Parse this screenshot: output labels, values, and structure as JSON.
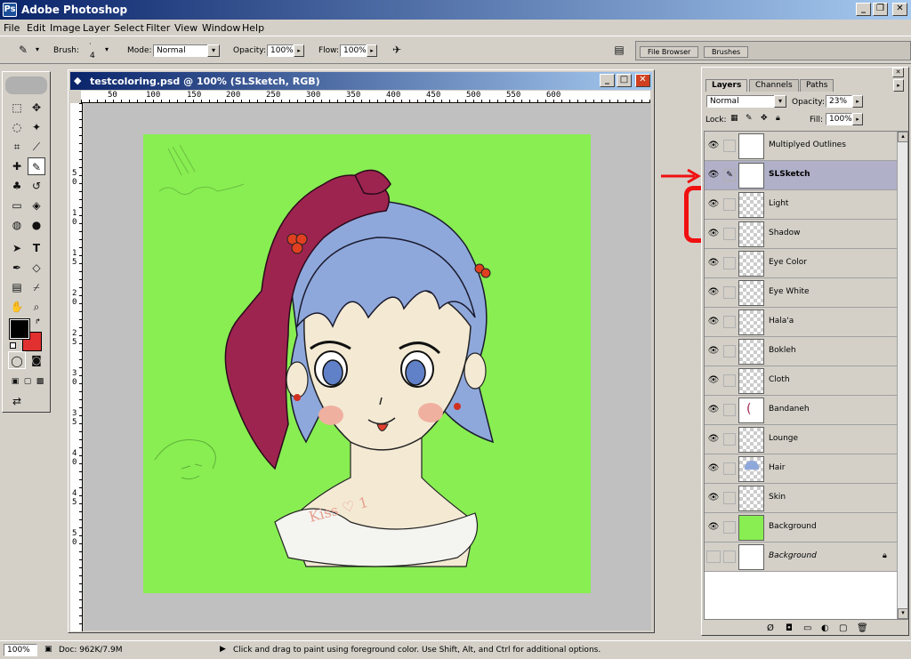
{
  "app": {
    "title": "Adobe Photoshop"
  },
  "menu": [
    "File",
    "Edit",
    "Image",
    "Layer",
    "Select",
    "Filter",
    "View",
    "Window",
    "Help"
  ],
  "options": {
    "brush_label": "Brush:",
    "brush_size": "4",
    "mode_label": "Mode:",
    "mode_value": "Normal",
    "opacity_label": "Opacity:",
    "opacity_value": "100%",
    "flow_label": "Flow:",
    "flow_value": "100%"
  },
  "palette_well": {
    "tabs": [
      "File Browser",
      "Brushes"
    ]
  },
  "document": {
    "title": "testcoloring.psd @ 100% (SLSketch, RGB)",
    "ruler_h": [
      "50",
      "100",
      "150",
      "200",
      "250",
      "300",
      "350",
      "400",
      "450",
      "500",
      "550",
      "600"
    ],
    "ruler_v": [
      "5",
      "0",
      "1",
      "0",
      "1",
      "5",
      "2",
      "0",
      "2",
      "5",
      "3",
      "0",
      "3",
      "5",
      "4",
      "0",
      "4",
      "5",
      "5",
      "0"
    ]
  },
  "layers_panel": {
    "tabs": [
      "Layers",
      "Channels",
      "Paths"
    ],
    "blend_mode": "Normal",
    "opacity_label": "Opacity:",
    "opacity_value": "23%",
    "lock_label": "Lock:",
    "fill_label": "Fill:",
    "fill_value": "100%",
    "layers": [
      {
        "name": "Multiplyed Outlines",
        "visible": true,
        "selected": false
      },
      {
        "name": "SLSketch",
        "visible": true,
        "selected": true
      },
      {
        "name": "Light",
        "visible": true,
        "selected": false
      },
      {
        "name": "Shadow",
        "visible": true,
        "selected": false
      },
      {
        "name": "Eye Color",
        "visible": true,
        "selected": false
      },
      {
        "name": "Eye White",
        "visible": true,
        "selected": false
      },
      {
        "name": "Hala'a",
        "visible": true,
        "selected": false
      },
      {
        "name": "Bokleh",
        "visible": true,
        "selected": false
      },
      {
        "name": "Cloth",
        "visible": true,
        "selected": false
      },
      {
        "name": "Bandaneh",
        "visible": true,
        "selected": false
      },
      {
        "name": "Lounge",
        "visible": true,
        "selected": false
      },
      {
        "name": "Hair",
        "visible": true,
        "selected": false
      },
      {
        "name": "Skin",
        "visible": true,
        "selected": false
      },
      {
        "name": "Background",
        "visible": true,
        "selected": false
      },
      {
        "name": "Background",
        "visible": false,
        "selected": false
      }
    ]
  },
  "annotation": {
    "text": "empty",
    "color": "#f01010"
  },
  "status": {
    "zoom": "100%",
    "doc_info": "Doc: 962K/7.9M",
    "hint": "Click and drag to paint using foreground color.  Use Shift, Alt, and Ctrl for additional options."
  },
  "colors": {
    "canvas_bg": "#88ee52",
    "hair": "#8fa8dc",
    "bandana": "#9e2450",
    "foreground": "#000000",
    "background": "#e03030"
  }
}
